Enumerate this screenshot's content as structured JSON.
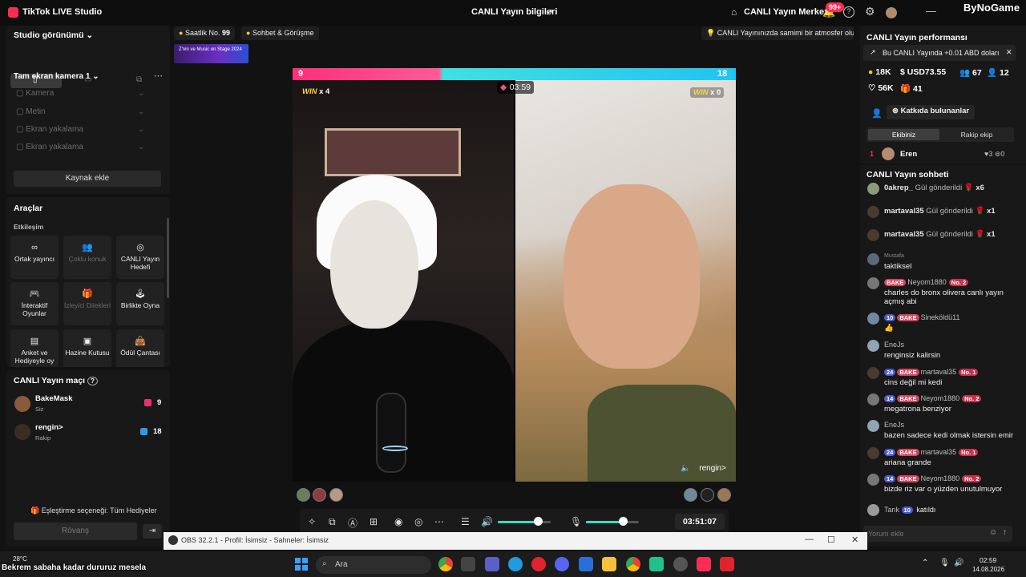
{
  "titlebar": {
    "app_title": "TikTok LIVE Studio",
    "center_title": "CANLI Yayın bilgileri",
    "live_center": "CANLI Yayın Merkezi",
    "notif_badge": "99+",
    "watermark": "ByNoGame"
  },
  "left": {
    "studio_view": "Studio görünümü",
    "camera_title": "Tam ekran kamera 1",
    "sources": [
      "Kamera",
      "Metin",
      "Ekran yakalama",
      "Ekran yakalama"
    ],
    "add_source": "Kaynak ekle",
    "tools_heading": "Araçlar",
    "interaction_heading": "Etkileşim",
    "tools": [
      {
        "label": "Ortak yayıncı",
        "icon": "link-icon",
        "enabled": true
      },
      {
        "label": "Çoklu konuk",
        "icon": "users-icon",
        "enabled": false
      },
      {
        "label": "CANLI Yayın Hedefi",
        "icon": "target-icon",
        "enabled": true
      },
      {
        "label": "İnteraktif Oyunlar",
        "icon": "gamepad-icon",
        "enabled": true
      },
      {
        "label": "İzleyici Dilekleri",
        "icon": "gift-icon",
        "enabled": false
      },
      {
        "label": "Birlikte Oyna",
        "icon": "joystick-icon",
        "enabled": true
      },
      {
        "label": "Anket ve Hediyeyle oy",
        "icon": "poll-icon",
        "enabled": true
      },
      {
        "label": "Hazine Kutusu",
        "icon": "chest-icon",
        "enabled": true
      },
      {
        "label": "Ödül Çantası",
        "icon": "bag-icon",
        "enabled": true
      }
    ],
    "match_heading": "CANLI Yayın maçı",
    "players": [
      {
        "name": "BakeMask",
        "role": "Siz",
        "score": "9"
      },
      {
        "name": "rengin>",
        "role": "Rakip",
        "score": "18"
      }
    ],
    "pairing": "Eşleştirme seçeneği: Tüm Hediyeler",
    "rematch": "Rövanş"
  },
  "topstrip": {
    "hourly_label": "Saatlik No.",
    "hourly_value": "99",
    "chat_chip": "Sohbet & Görüşme",
    "tip": "CANLI Yayınınızda samimi bir atmosfer olu...",
    "banner_text": "Z'nin ve Music on Stage 2024"
  },
  "stage": {
    "left_score": "9",
    "right_score": "18",
    "left_win": "x 4",
    "right_win": "x 0",
    "win_word": "WIN",
    "timer": "03:59",
    "right_name": "rengin>"
  },
  "controls": {
    "clock": "03:51:07",
    "volume_level": 0.75,
    "mic_level": 0.7
  },
  "right": {
    "perf_heading": "CANLI Yayın performansı",
    "earning_note": "Bu CANLI Yayında +0.01 ABD doları",
    "stats": {
      "likes": "18K",
      "usd": "USD73.55",
      "viewers": "67",
      "follows": "12",
      "hearts": "56K",
      "gifters": "41"
    },
    "contributors_btn": "Katkıda bulunanlar",
    "tab_team": "Ekibiniz",
    "tab_rival": "Rakip ekip",
    "top_contrib": {
      "rank": "1",
      "name": "Eren",
      "hearts": "3",
      "gifts": "0"
    },
    "chat_heading": "CANLI Yayın sohbeti",
    "gifts": [
      {
        "name": "0akrep_",
        "text": "Gül gönderildi",
        "count": "x6"
      },
      {
        "name": "martaval35",
        "text": "Gül gönderildi",
        "count": "x1"
      },
      {
        "name": "martaval35",
        "text": "Gül gönderildi",
        "count": "x1"
      }
    ],
    "messages": [
      {
        "name": "Mustafa",
        "level": "",
        "fan": "",
        "rank": "",
        "text": "taktiksel"
      },
      {
        "name": "Neyom1880",
        "level": "",
        "fan": "BAKE",
        "rank": "No. 2",
        "text": "charles do bronx olivera canlı yayın açmış abi"
      },
      {
        "name": "Sineköldü11",
        "level": "10",
        "fan": "BAKE",
        "rank": "",
        "text": "👍"
      },
      {
        "name": "EneJs",
        "level": "",
        "fan": "",
        "rank": "",
        "text": "renginsiz kalirsin"
      },
      {
        "name": "martaval35",
        "level": "24",
        "fan": "BAKE",
        "rank": "No. 1",
        "text": "cins değil mi kedi"
      },
      {
        "name": "Neyom1880",
        "level": "14",
        "fan": "BAKE",
        "rank": "No. 2",
        "text": "megatrona benziyor"
      },
      {
        "name": "EneJs",
        "level": "",
        "fan": "",
        "rank": "",
        "text": "bazen sadece kedi olmak istersin emir"
      },
      {
        "name": "martaval35",
        "level": "24",
        "fan": "BAKE",
        "rank": "No. 1",
        "text": "ariana grande"
      },
      {
        "name": "Neyom1880",
        "level": "14",
        "fan": "BAKE",
        "rank": "No. 2",
        "text": "bizde riz var o yüzden unutulmuyor"
      }
    ],
    "join_name": "Tank",
    "join_level": "10",
    "join_text": "katıldı",
    "comment_placeholder": "Yorum ekle"
  },
  "obs": {
    "title": "OBS 32.2.1 - Profil: İsimsiz - Sahneler: İsimsiz"
  },
  "taskbar": {
    "search": "Ara",
    "temp": "28°C",
    "time": "02:59",
    "date": "14.08.2026"
  },
  "subtitle": "Bekrem sabaha kadar dururuz mesela"
}
